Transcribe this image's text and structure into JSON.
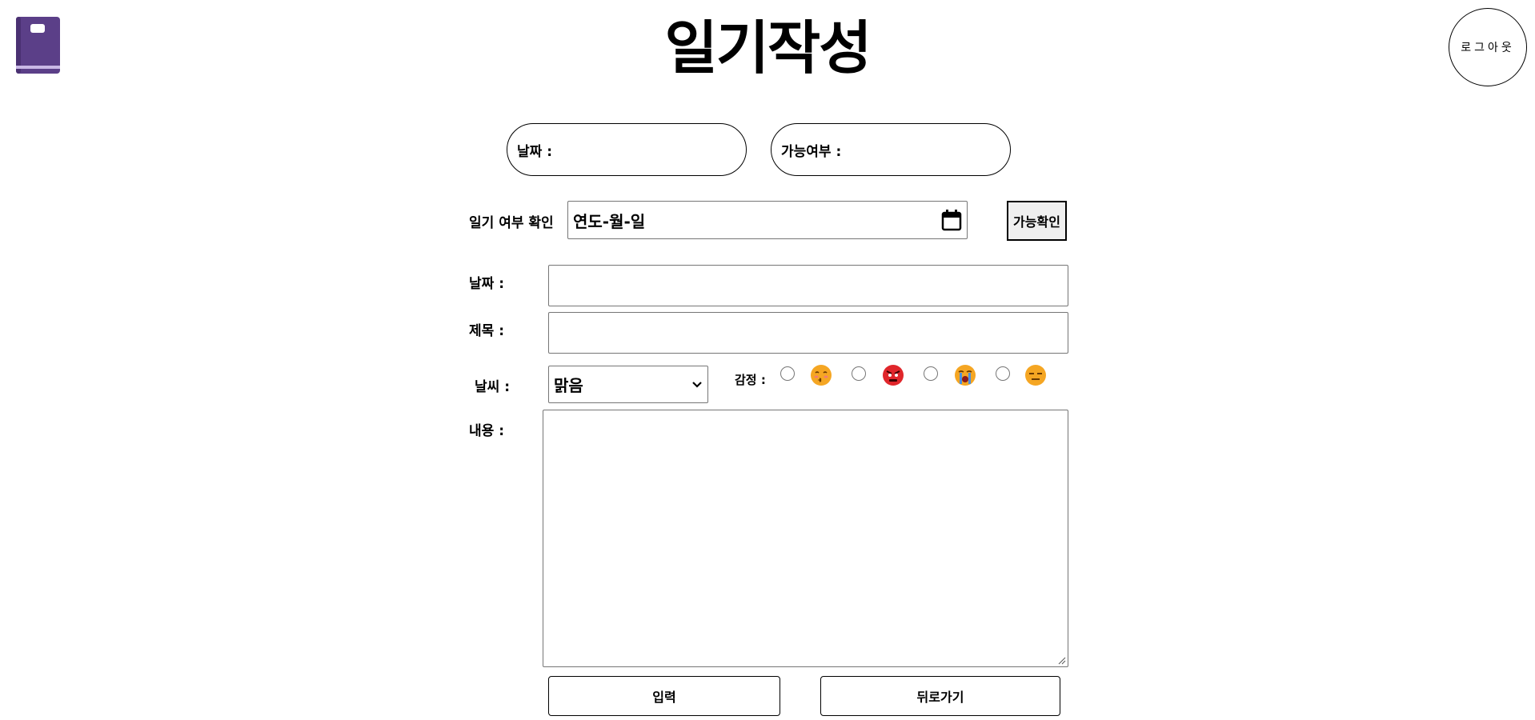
{
  "header": {
    "title": "일기작성",
    "logout_label": "로그아웃",
    "logo_icon": "diary-book-icon"
  },
  "summary": {
    "date_label": "날짜 :",
    "availability_label": "가능여부 :"
  },
  "check": {
    "label": "일기 여부 확인",
    "date_placeholder": "연도-월-일",
    "button_label": "가능확인"
  },
  "form": {
    "date_label": "날짜 :",
    "date_value": "",
    "title_label": "제목 :",
    "title_value": "",
    "weather_label": "날씨 :",
    "weather_selected": "맑음",
    "emotion_label": "감정 :",
    "emotions": [
      {
        "icon": "kissing-face-icon",
        "checked": false
      },
      {
        "icon": "angry-face-icon",
        "checked": false
      },
      {
        "icon": "crying-face-icon",
        "checked": false
      },
      {
        "icon": "expressionless-face-icon",
        "checked": false
      }
    ],
    "content_label": "내용 :",
    "content_value": ""
  },
  "actions": {
    "submit_label": "입력",
    "back_label": "뒤로가기"
  },
  "colors": {
    "logo_purple": "#5b3f88",
    "emoji_yellow": "#f5a623",
    "emoji_red": "#e0262b"
  }
}
